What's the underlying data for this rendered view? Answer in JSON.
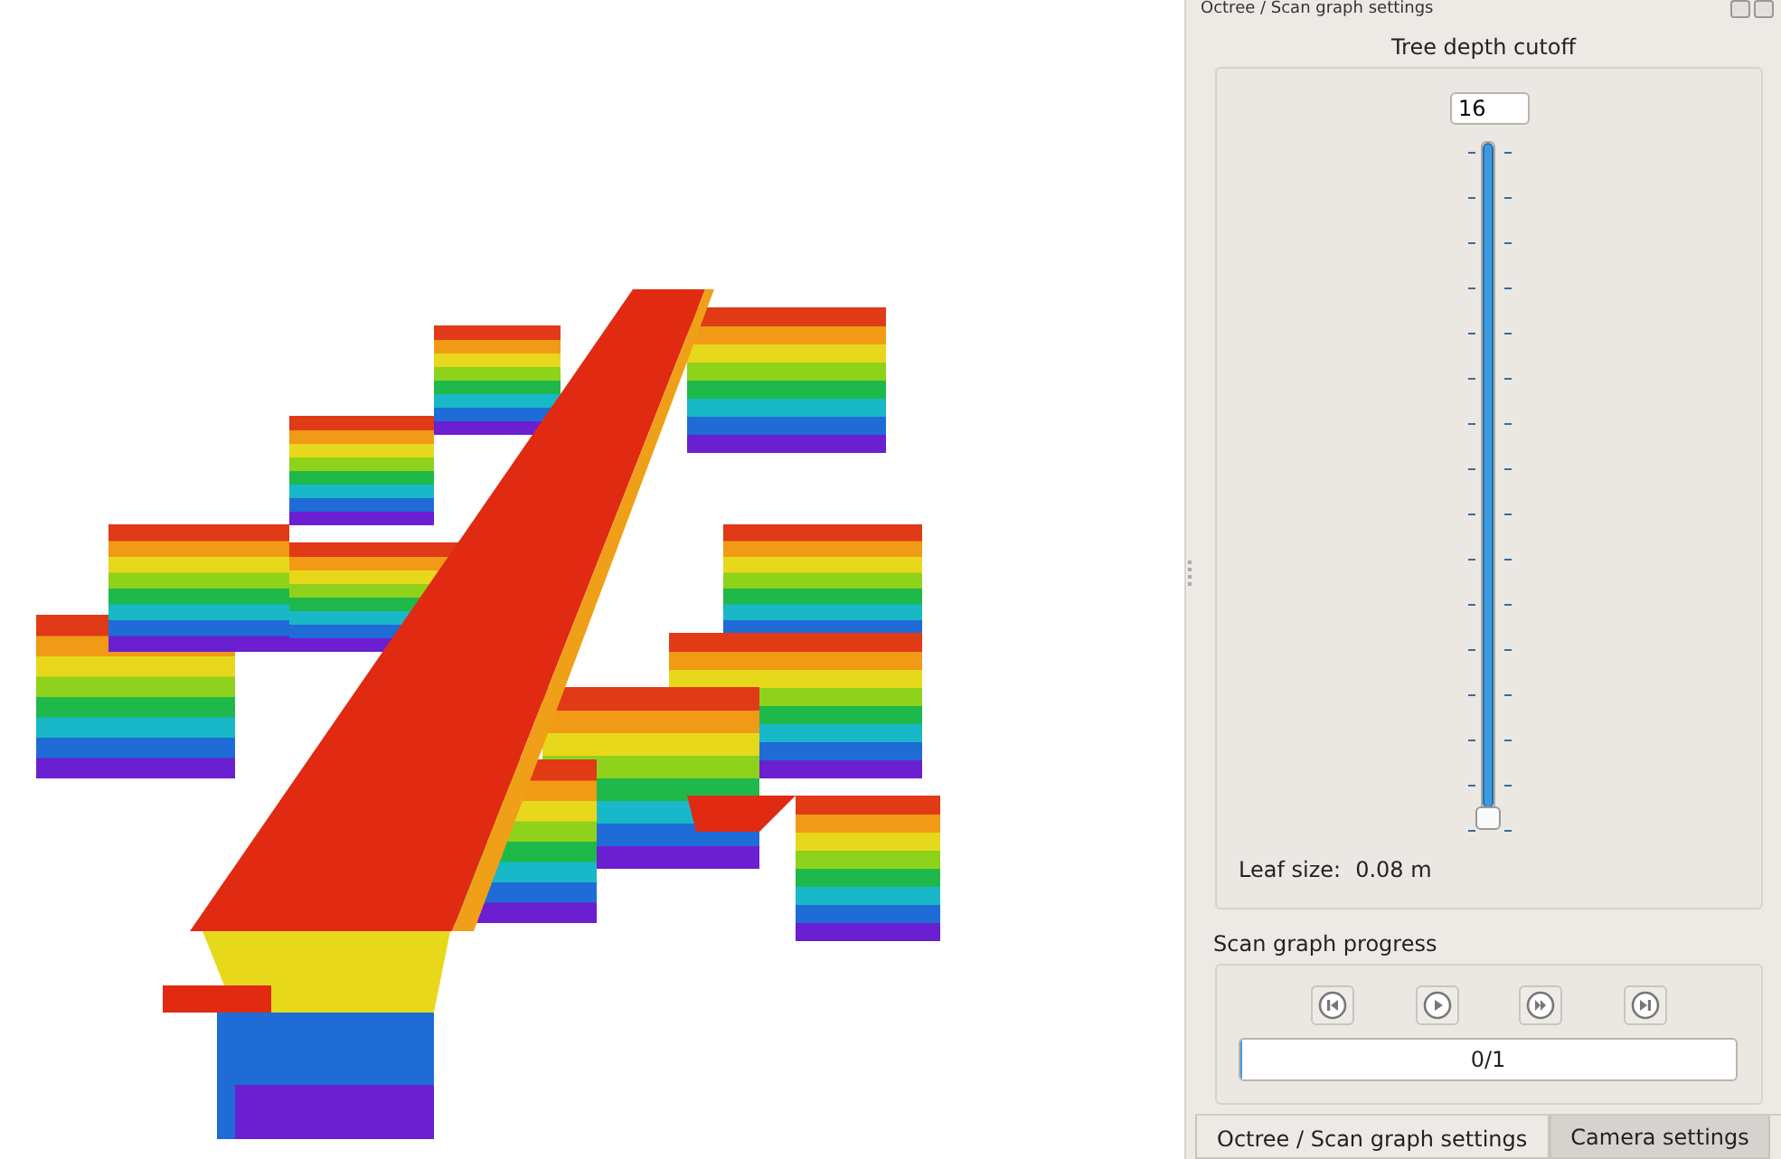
{
  "dock": {
    "title": "Octree / Scan graph settings"
  },
  "depth": {
    "title": "Tree depth cutoff",
    "value": "16",
    "level": 1,
    "leaf_label": "Leaf size:",
    "leaf_value": "0.08 m"
  },
  "progress": {
    "title": "Scan graph progress",
    "buttons": [
      {
        "kind": "first"
      },
      {
        "kind": "play"
      },
      {
        "kind": "forward"
      },
      {
        "kind": "last"
      }
    ],
    "bar_text": "0/1",
    "level": 0
  },
  "tabs": [
    {
      "label": "Octree / Scan graph settings",
      "selected": true
    },
    {
      "label": "Camera settings",
      "selected": false
    }
  ]
}
